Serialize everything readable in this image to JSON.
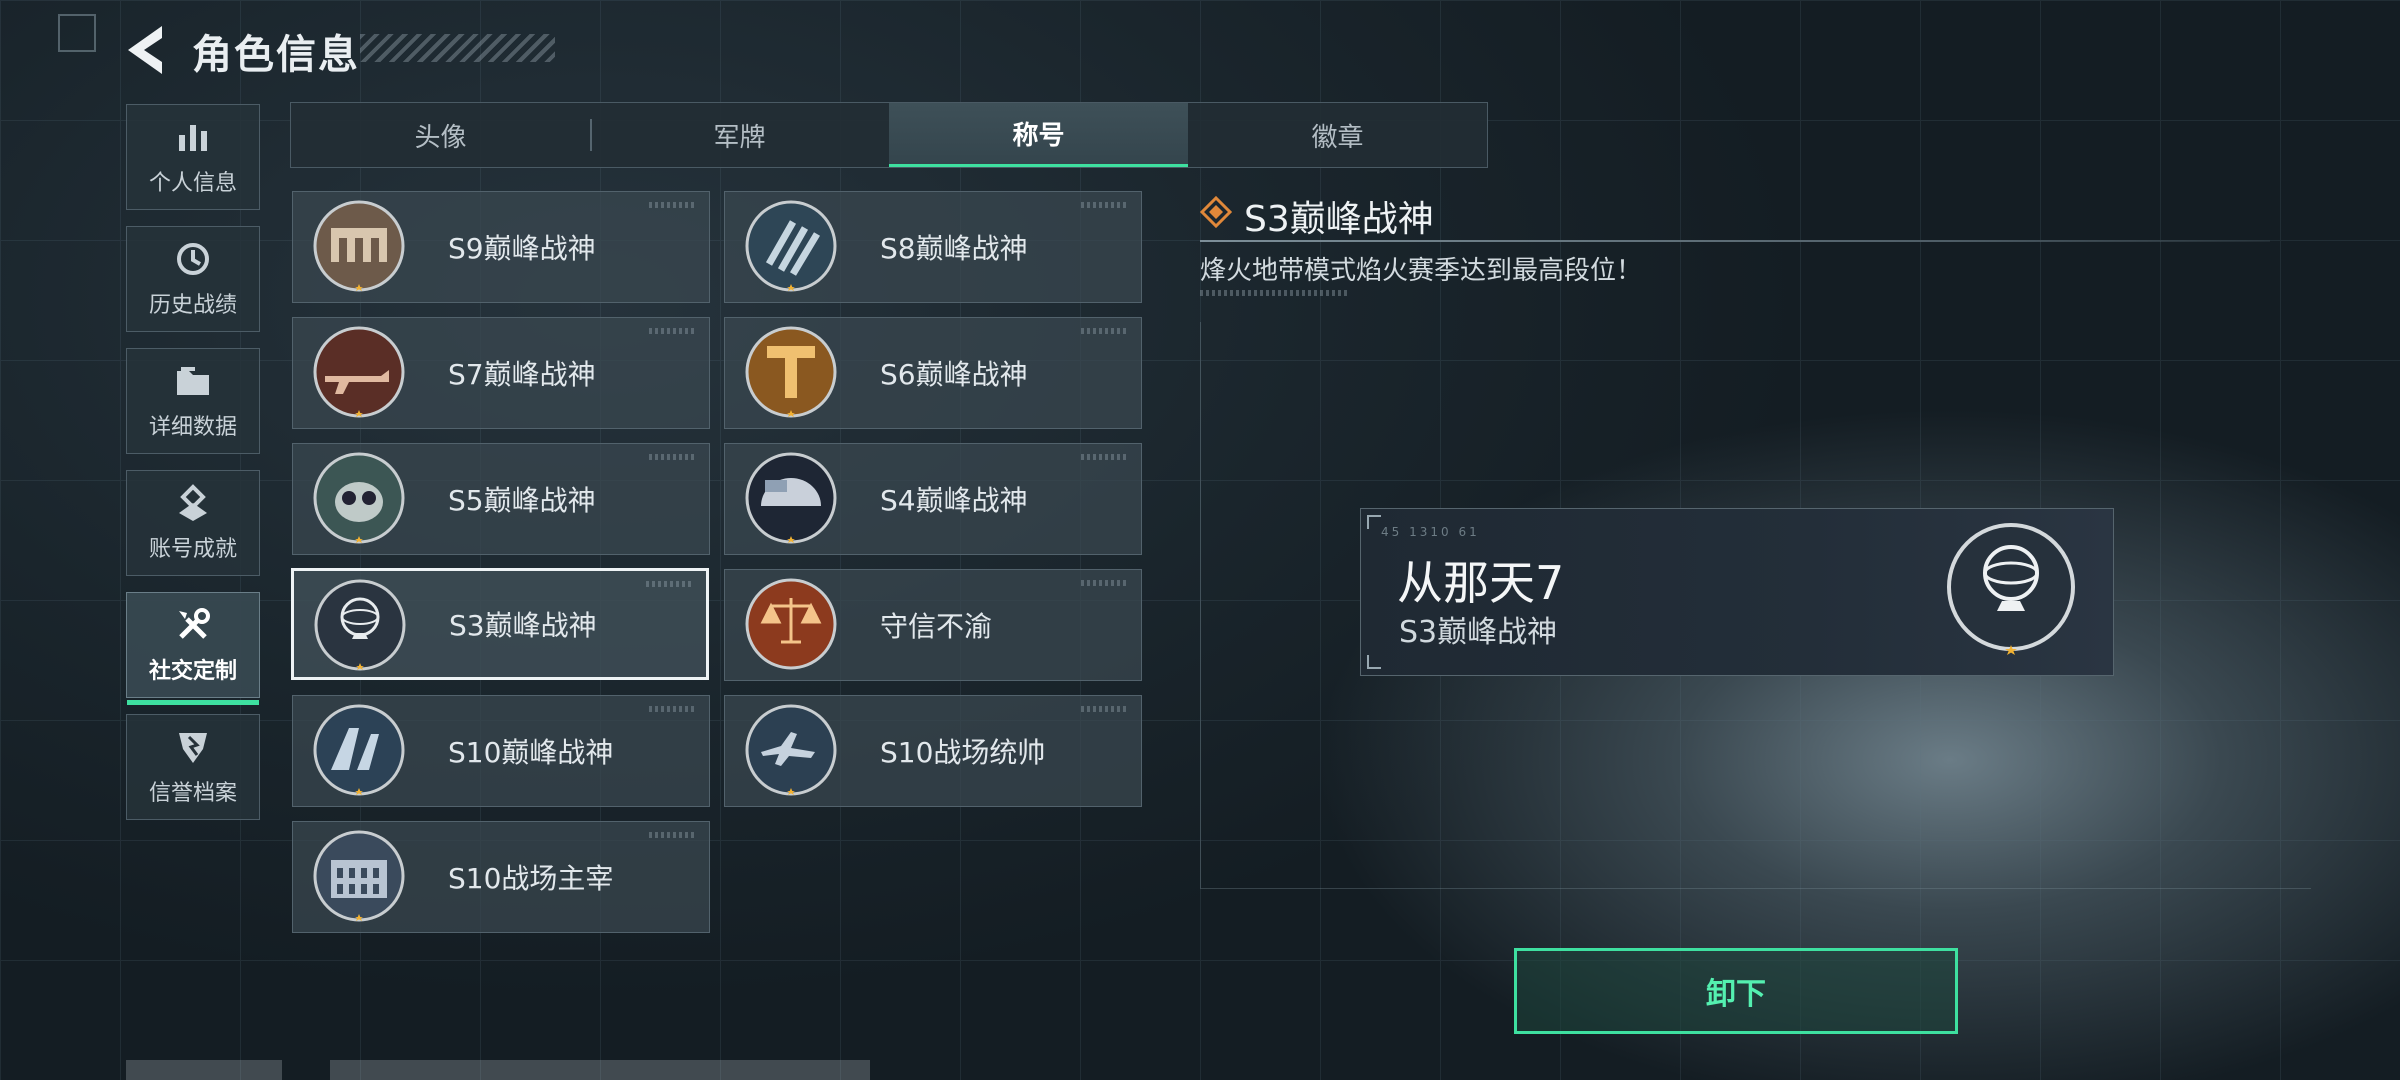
{
  "header": {
    "title": "角色信息"
  },
  "sidebar": {
    "items": [
      {
        "label": "个人信息",
        "icon": "bar-chart-icon"
      },
      {
        "label": "历史战绩",
        "icon": "history-icon"
      },
      {
        "label": "详细数据",
        "icon": "folder-icon"
      },
      {
        "label": "账号成就",
        "icon": "achievement-icon"
      },
      {
        "label": "社交定制",
        "icon": "tools-icon",
        "active": true
      },
      {
        "label": "信誉档案",
        "icon": "credit-shield-icon"
      }
    ]
  },
  "tabs": [
    {
      "label": "头像"
    },
    {
      "label": "军牌"
    },
    {
      "label": "称号",
      "active": true
    },
    {
      "label": "徽章"
    }
  ],
  "titles": [
    {
      "name": "S9巅峰战神",
      "emblem": "fortress-emblem-icon"
    },
    {
      "name": "S8巅峰战神",
      "emblem": "stripes-emblem-icon"
    },
    {
      "name": "S7巅峰战神",
      "emblem": "rifle-emblem-icon"
    },
    {
      "name": "S6巅峰战神",
      "emblem": "tshield-emblem-icon"
    },
    {
      "name": "S5巅峰战神",
      "emblem": "gasmask-emblem-icon"
    },
    {
      "name": "S4巅峰战神",
      "emblem": "helmet-emblem-icon"
    },
    {
      "name": "S3巅峰战神",
      "emblem": "globe-emblem-icon",
      "selected": true
    },
    {
      "name": "守信不渝",
      "emblem": "scales-emblem-icon"
    },
    {
      "name": "S10巅峰战神",
      "emblem": "bridge-emblem-icon"
    },
    {
      "name": "S10战场统帅",
      "emblem": "aircraft-emblem-icon"
    },
    {
      "name": "S10战场主宰",
      "emblem": "colosseum-emblem-icon"
    }
  ],
  "detail": {
    "title": "S3巅峰战神",
    "description": "烽火地带模式焰火赛季达到最高段位！",
    "preview": {
      "tag": "45 1310 61",
      "player_name": "从那天7",
      "title": "S3巅峰战神"
    },
    "unequip_label": "卸下"
  },
  "colors": {
    "accent": "#3ee0a0",
    "diamond": "#e0883a",
    "star": "#f2b233"
  }
}
